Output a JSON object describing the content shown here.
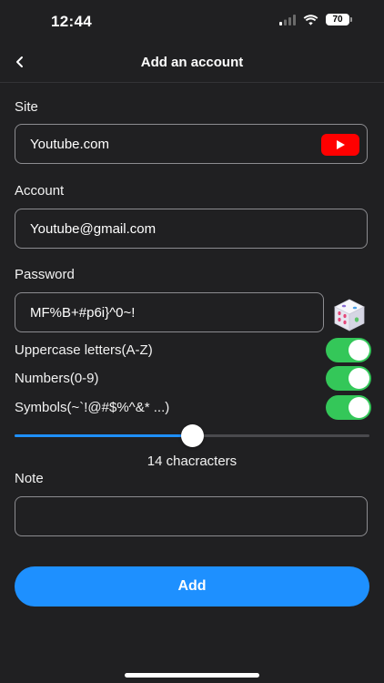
{
  "status_bar": {
    "time": "12:44",
    "battery": "70"
  },
  "nav": {
    "title": "Add an account",
    "back_icon": "chevron-left-icon"
  },
  "site": {
    "label": "Site",
    "value": "Youtube.com",
    "icon": "youtube-icon"
  },
  "account": {
    "label": "Account",
    "value": "Youtube@gmail.com"
  },
  "password": {
    "label": "Password",
    "value": "MF%B+#p6i}^0~!",
    "generate_icon": "dice-icon"
  },
  "options": [
    {
      "label": "Uppercase letters(A-Z)",
      "enabled": true
    },
    {
      "label": "Numbers(0-9)",
      "enabled": true
    },
    {
      "label": "Symbols(~`!@#$%^&* ...)",
      "enabled": true
    }
  ],
  "length": {
    "value": 14,
    "fraction": 0.5,
    "text": "14 chacracters"
  },
  "note": {
    "label": "Note",
    "value": ""
  },
  "add_button": {
    "label": "Add"
  },
  "colors": {
    "background": "#202022",
    "accent": "#1e90ff",
    "toggle_on": "#34c759",
    "youtube_red": "#ff0000"
  }
}
